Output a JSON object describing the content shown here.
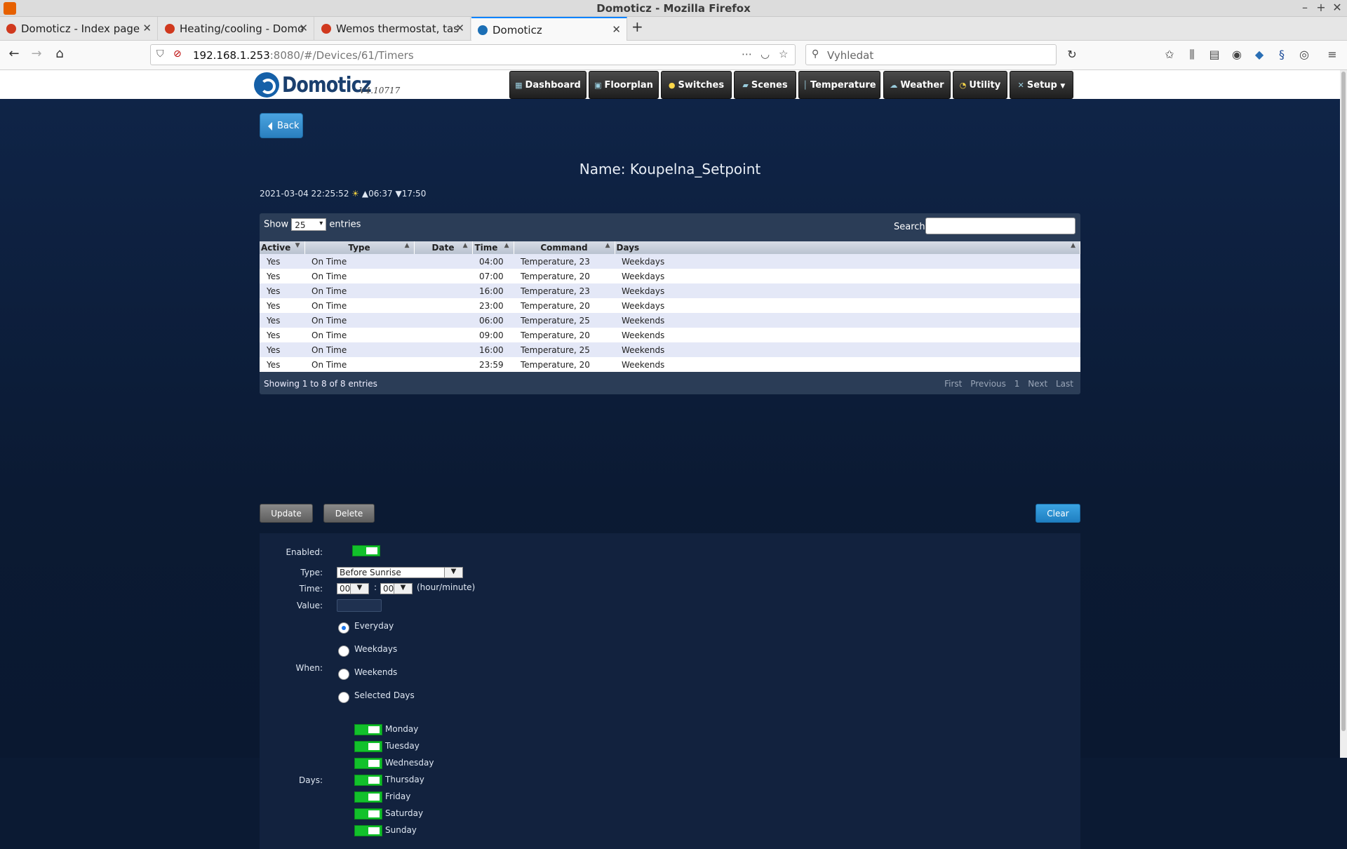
{
  "browser": {
    "window_title": "Domoticz - Mozilla Firefox",
    "tabs": [
      {
        "label": "Domoticz - Index page"
      },
      {
        "label": "Heating/cooling - Domo"
      },
      {
        "label": "Wemos thermostat, tas"
      },
      {
        "label": "Domoticz"
      }
    ],
    "url_host": "192.168.1.253",
    "url_rest": ":8080/#/Devices/61/Timers",
    "search_placeholder": "Vyhledat"
  },
  "app": {
    "logo_text": "Domoticz",
    "version": "V4.10717",
    "menu": [
      {
        "label": "Dashboard"
      },
      {
        "label": "Floorplan"
      },
      {
        "label": "Switches"
      },
      {
        "label": "Scenes"
      },
      {
        "label": "Temperature"
      },
      {
        "label": "Weather"
      },
      {
        "label": "Utility"
      },
      {
        "label": "Setup"
      }
    ]
  },
  "page": {
    "back_label": "Back",
    "name": "Name: Koupelna_Setpoint",
    "datetime": "2021-03-04 22:25:52",
    "sunrise": "▲06:37",
    "sunset": "▼17:50"
  },
  "table": {
    "show_label": "Show",
    "entries_label": "entries",
    "length_value": "25",
    "search_label": "Search:",
    "columns": [
      "Active",
      "Type",
      "Date",
      "Time",
      "Command",
      "Days"
    ],
    "rows": [
      [
        "Yes",
        "On Time",
        "",
        "04:00",
        "Temperature, 23",
        "Weekdays"
      ],
      [
        "Yes",
        "On Time",
        "",
        "07:00",
        "Temperature, 20",
        "Weekdays"
      ],
      [
        "Yes",
        "On Time",
        "",
        "16:00",
        "Temperature, 23",
        "Weekdays"
      ],
      [
        "Yes",
        "On Time",
        "",
        "23:00",
        "Temperature, 20",
        "Weekdays"
      ],
      [
        "Yes",
        "On Time",
        "",
        "06:00",
        "Temperature, 25",
        "Weekends"
      ],
      [
        "Yes",
        "On Time",
        "",
        "09:00",
        "Temperature, 20",
        "Weekends"
      ],
      [
        "Yes",
        "On Time",
        "",
        "16:00",
        "Temperature, 25",
        "Weekends"
      ],
      [
        "Yes",
        "On Time",
        "",
        "23:59",
        "Temperature, 20",
        "Weekends"
      ]
    ],
    "info": "Showing 1 to 8 of 8 entries",
    "pager": {
      "first": "First",
      "previous": "Previous",
      "page": "1",
      "next": "Next",
      "last": "Last"
    }
  },
  "actions": {
    "update": "Update",
    "delete": "Delete",
    "clear": "Clear"
  },
  "form": {
    "enabled_label": "Enabled:",
    "enabled": true,
    "type_label": "Type:",
    "type_value": "Before Sunrise",
    "time_label": "Time:",
    "hour": "00",
    "minute": "00",
    "time_sep": ":",
    "time_unit": "(hour/minute)",
    "value_label": "Value:",
    "when_label": "When:",
    "when_options": [
      "Everyday",
      "Weekdays",
      "Weekends",
      "Selected Days"
    ],
    "when_selected": "Everyday",
    "days_label": "Days:",
    "days": [
      "Monday",
      "Tuesday",
      "Wednesday",
      "Thursday",
      "Friday",
      "Saturday",
      "Sunday"
    ]
  }
}
